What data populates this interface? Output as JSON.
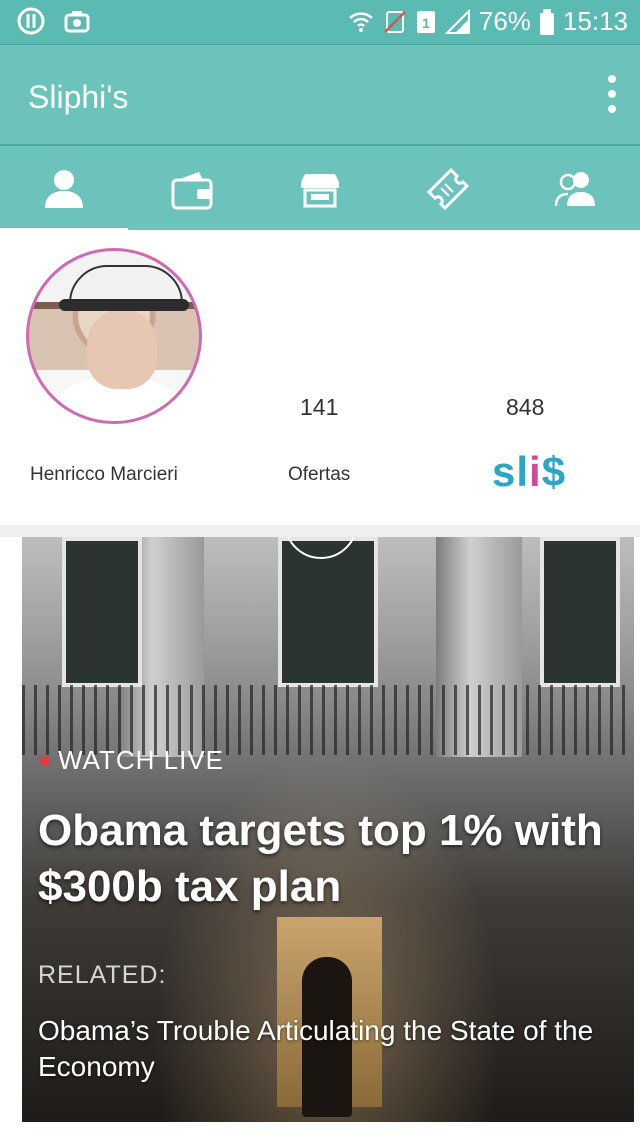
{
  "statusbar": {
    "battery": "76%",
    "time": "15:13",
    "left_icons": [
      "circle-logo-icon",
      "camera-icon"
    ],
    "right_icons": [
      "wifi-icon",
      "no-sim-icon",
      "sim-1-icon",
      "signal-icon",
      "battery-icon"
    ]
  },
  "appbar": {
    "title": "Sliphi's",
    "menu_icon": "more-vert-icon"
  },
  "tabs": [
    {
      "name": "profile",
      "icon": "person-icon",
      "active": true
    },
    {
      "name": "wallet",
      "icon": "wallet-icon",
      "active": false
    },
    {
      "name": "store",
      "icon": "store-icon",
      "active": false
    },
    {
      "name": "coupons",
      "icon": "ticket-icon",
      "active": false
    },
    {
      "name": "friends",
      "icon": "group-icon",
      "active": false
    }
  ],
  "profile": {
    "name": "Henricco Marcieri",
    "offers_count": "141",
    "offers_label": "Ofertas",
    "slis_count": "848",
    "slis_logo": "slis"
  },
  "news": {
    "live_label": "WATCH LIVE",
    "headline": "Obama targets top 1% with $300b tax plan",
    "related_label": "RELATED:",
    "related_text": "Obama’s Trouble Articulating the State of the Economy"
  },
  "colors": {
    "teal": "#6cc3bb",
    "teal_dark": "#5bbab2",
    "slis_blue": "#2aa6c6",
    "accent_pink": "#d06ab0",
    "live_red": "#e23b3b"
  }
}
